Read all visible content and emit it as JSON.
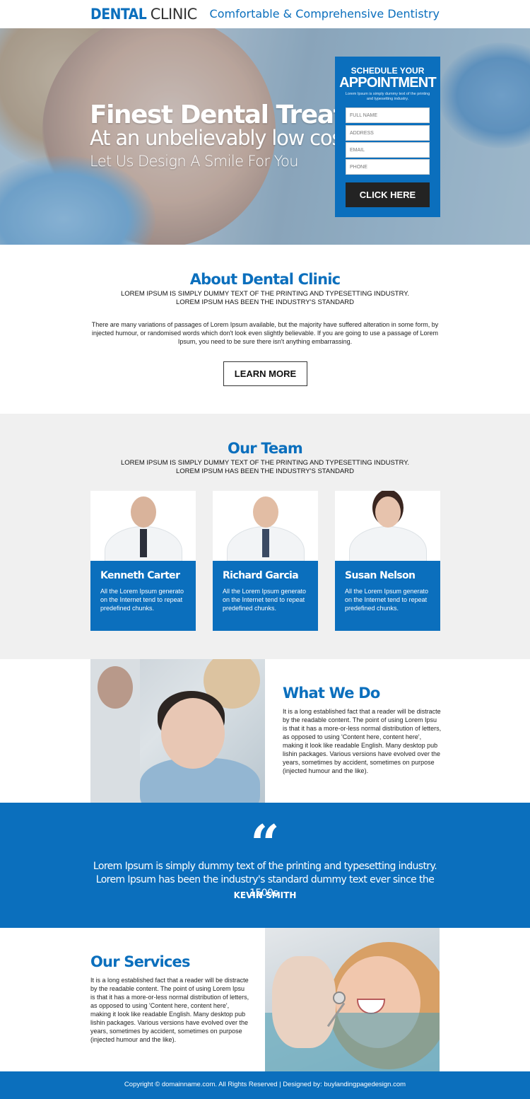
{
  "header": {
    "logo_bold": "DENTAL",
    "logo_light": "CLINIC",
    "tagline": "Comfortable & Comprehensive Dentistry"
  },
  "hero": {
    "headline": "Finest Dental Treatment",
    "subheadline": "At an unbelievably low cost",
    "tagline": "Let Us Design A Smile For You"
  },
  "form": {
    "title_top": "SCHEDULE YOUR",
    "title_main": "APPOINTMENT",
    "description": "Lorem Ipsum is simply dummy text of the printing and typesetting industry.",
    "fields": {
      "full_name": "FULL NAME",
      "address": "ADDRESS",
      "email": "EMAIL",
      "phone": "PHONE"
    },
    "button": "CLICK HERE"
  },
  "about": {
    "title": "About Dental Clinic",
    "line1": "LOREM IPSUM IS SIMPLY DUMMY TEXT OF THE PRINTING AND TYPESETTING INDUSTRY.",
    "line2": "LOREM IPSUM HAS BEEN THE INDUSTRY'S STANDARD",
    "paragraph": "There are many variations of passages of Lorem Ipsum available, but the majority have suffered alteration in some form, by injected humour, or randomised words which don't look even slightly believable. If you are going to use a passage of Lorem Ipsum, you need to be sure there isn't anything embarrassing.",
    "button": "LEARN MORE"
  },
  "team": {
    "title": "Our Team",
    "line1": "LOREM IPSUM IS SIMPLY DUMMY TEXT OF THE PRINTING AND TYPESETTING INDUSTRY.",
    "line2": "LOREM IPSUM HAS BEEN THE INDUSTRY'S STANDARD",
    "members": [
      {
        "name": "Kenneth Carter",
        "desc": "All the Lorem Ipsum generato on the Internet tend to repeat predefined chunks."
      },
      {
        "name": "Richard Garcia",
        "desc": "All the Lorem Ipsum generato on the Internet tend to repeat predefined chunks."
      },
      {
        "name": "Susan Nelson",
        "desc": "All the Lorem Ipsum generato on the Internet tend to repeat predefined chunks."
      }
    ]
  },
  "what_we_do": {
    "title": "What We Do",
    "paragraph": "It is a long established fact that a reader will be distracte by the readable content. The point of using Lorem Ipsu is that it has a more-or-less normal distribution of letters, as opposed to using 'Content here, content here', making it look like readable English. Many desktop pub lishin packages. Various versions have evolved over the years, sometimes by accident, sometimes on purpose (injected humour and the like)."
  },
  "testimonial": {
    "quote_mark": "“",
    "text": "Lorem Ipsum is simply dummy text of the printing and typesetting industry. Lorem Ipsum has been the industry's standard dummy text ever since the 1500s.",
    "author": "KEVIN SMITH"
  },
  "services": {
    "title": "Our Services",
    "paragraph": "It is a long established fact that a reader will be distracte by the readable content. The point of using Lorem Ipsu is that it has a more-or-less normal distribution of letters, as opposed to using 'Content here, content here', making it look like readable English. Many desktop pub lishin packages. Various versions have evolved over the years, sometimes by accident, sometimes on purpose (injected humour and the like)."
  },
  "footer": {
    "text": "Copyright © domainname.com. All Rights Reserved  |  Designed by: buylandingpagedesign.com"
  },
  "colors": {
    "brand_blue": "#0b6fbd",
    "button_dark": "#232323",
    "team_bg": "#f0f0f0"
  }
}
